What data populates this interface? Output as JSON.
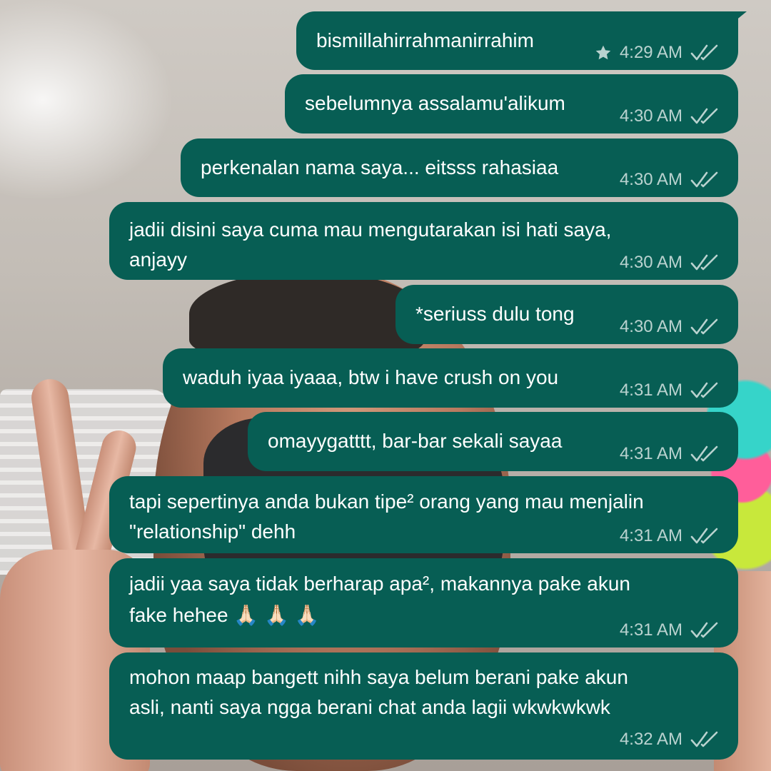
{
  "theme": {
    "bubble_color": "#075e54",
    "text_color": "#ffffff",
    "meta_color": "#b6d5cf"
  },
  "messages": [
    {
      "text": "bismillahirrahmanirrahim",
      "time": "4:29 AM",
      "starred": true,
      "status_icon": "double-check-icon"
    },
    {
      "text": "sebelumnya assalamu'alikum",
      "time": "4:30 AM",
      "starred": false,
      "status_icon": "double-check-icon"
    },
    {
      "text": "perkenalan nama saya... eitsss rahasiaa",
      "time": "4:30 AM",
      "starred": false,
      "status_icon": "double-check-icon"
    },
    {
      "text": "jadii disini saya cuma mau mengutarakan isi hati saya,\nanjayy",
      "time": "4:30 AM",
      "starred": false,
      "status_icon": "double-check-icon"
    },
    {
      "text": "*seriuss dulu tong",
      "time": "4:30 AM",
      "starred": false,
      "status_icon": "double-check-icon"
    },
    {
      "text": "waduh iyaa iyaaa, btw i have crush on you",
      "time": "4:31 AM",
      "starred": false,
      "status_icon": "double-check-icon"
    },
    {
      "text": "omayygatttt, bar-bar sekali sayaa",
      "time": "4:31 AM",
      "starred": false,
      "status_icon": "double-check-icon"
    },
    {
      "text": "tapi sepertinya anda bukan tipe² orang yang mau menjalin\n\"relationship\" dehh",
      "time": "4:31 AM",
      "starred": false,
      "status_icon": "double-check-icon"
    },
    {
      "text": "jadii yaa saya tidak berharap apa², makannya pake akun\nfake hehee 🙏🏻 🙏🏻 🙏🏻",
      "time": "4:31 AM",
      "starred": false,
      "status_icon": "double-check-icon"
    },
    {
      "text": "mohon maap bangett nihh saya belum berani pake akun\nasli, nanti saya ngga berani chat anda lagii wkwkwkwk",
      "time": "4:32 AM",
      "starred": false,
      "status_icon": "double-check-icon"
    }
  ]
}
